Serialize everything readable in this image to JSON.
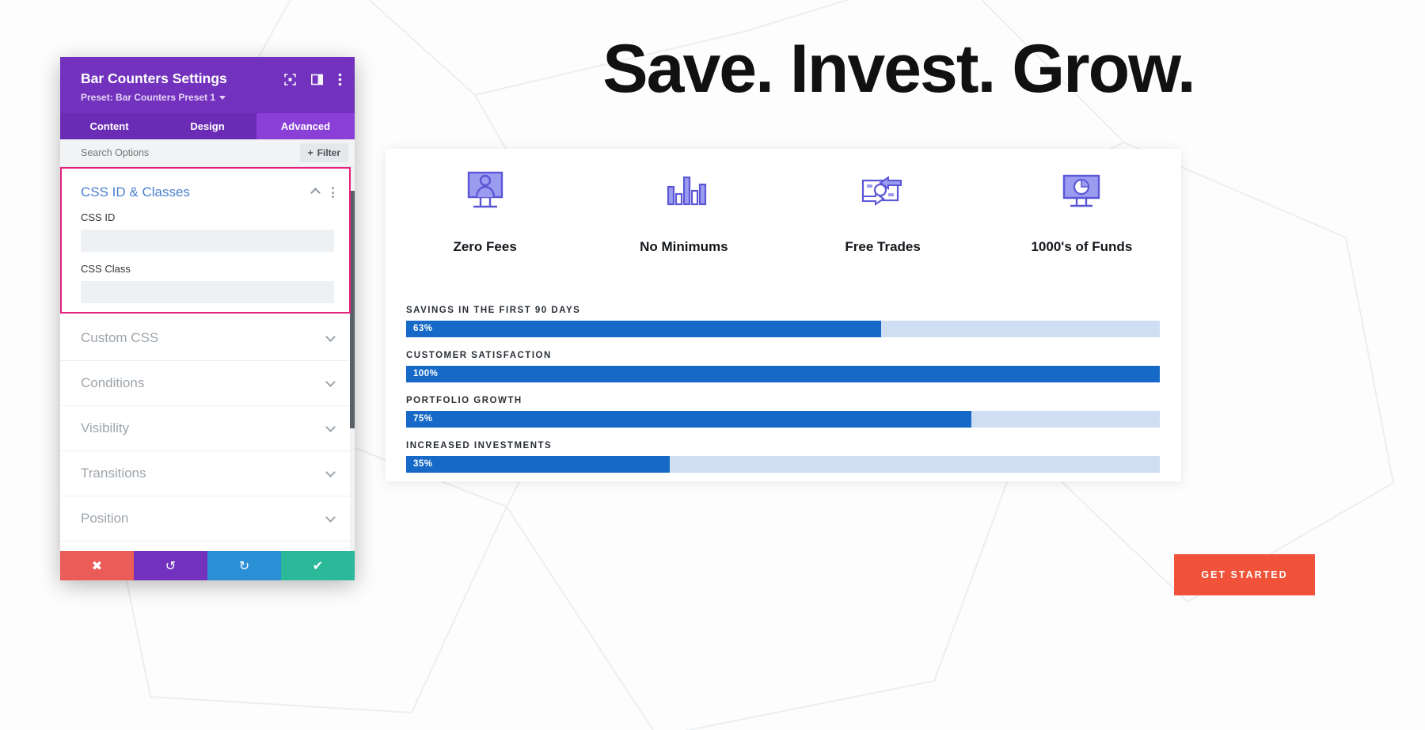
{
  "modal": {
    "title": "Bar Counters Settings",
    "preset": "Preset: Bar Counters Preset 1",
    "header_icons": [
      "fullscreen-icon",
      "layout-panel-icon",
      "kebab-menu-icon"
    ],
    "tabs": [
      {
        "label": "Content",
        "active": false
      },
      {
        "label": "Design",
        "active": false
      },
      {
        "label": "Advanced",
        "active": true
      }
    ],
    "search": {
      "placeholder": "Search Options",
      "value": ""
    },
    "filter_label": "Filter",
    "open_section": {
      "title": "CSS ID & Classes",
      "fields": [
        {
          "label": "CSS ID",
          "value": "",
          "placeholder": ""
        },
        {
          "label": "CSS Class",
          "value": "",
          "placeholder": ""
        }
      ]
    },
    "sections": [
      {
        "label": "Custom CSS"
      },
      {
        "label": "Conditions"
      },
      {
        "label": "Visibility"
      },
      {
        "label": "Transitions"
      },
      {
        "label": "Position"
      }
    ],
    "footer": [
      {
        "name": "cancel",
        "icon": "✖"
      },
      {
        "name": "undo",
        "icon": "↺"
      },
      {
        "name": "redo",
        "icon": "↻"
      },
      {
        "name": "save",
        "icon": "✔"
      }
    ],
    "colors": {
      "header": "#7232bd",
      "tab_active": "#8a3fd6",
      "highlight": "#e5217c",
      "section_title": "#4a7fd0"
    }
  },
  "preview": {
    "hero_title": "Save. Invest. Grow.",
    "features": [
      {
        "label": "Zero Fees",
        "icon": "monitor-person-icon"
      },
      {
        "label": "No Minimums",
        "icon": "bar-chart-icon"
      },
      {
        "label": "Free Trades",
        "icon": "money-exchange-icon"
      },
      {
        "label": "1000's of Funds",
        "icon": "monitor-pie-chart-icon"
      }
    ],
    "cta_label": "GET STARTED",
    "colors": {
      "bar_fill": "#1669c7",
      "bar_track": "#cfdef2",
      "cta": "#f0523a",
      "icon": "#6a67e0"
    }
  },
  "chart_data": {
    "type": "bar",
    "title": "",
    "orientation": "horizontal",
    "categories": [
      "SAVINGS IN THE FIRST 90 DAYS",
      "CUSTOMER SATISFACTION",
      "PORTFOLIO GROWTH",
      "INCREASED INVESTMENTS"
    ],
    "values": [
      63,
      100,
      75,
      35
    ],
    "value_labels": [
      "63%",
      "100%",
      "75%",
      "35%"
    ],
    "xlabel": "",
    "ylabel": "",
    "xlim": [
      0,
      100
    ],
    "grid": false,
    "legend": false
  }
}
